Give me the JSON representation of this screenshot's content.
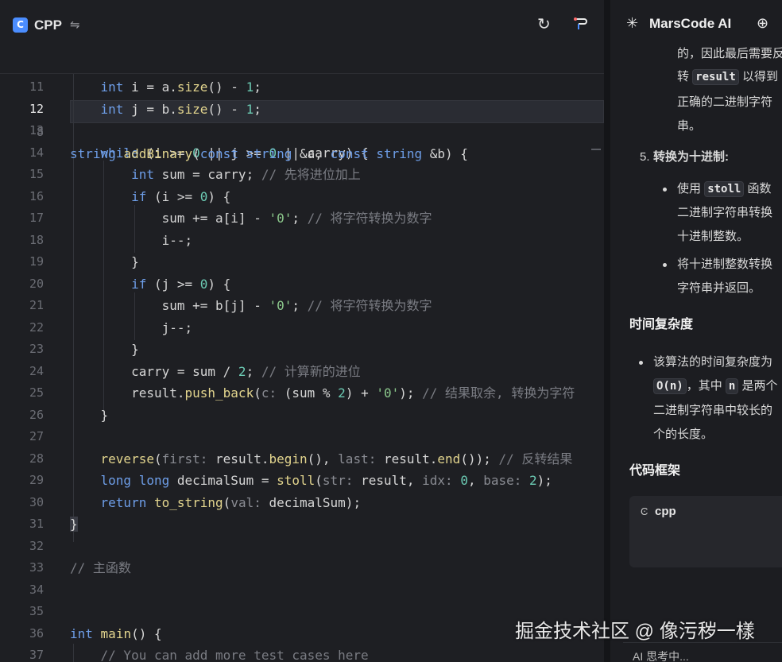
{
  "editor": {
    "language": "CPP",
    "language_icon": "C",
    "sticky_line_number": "8",
    "lines": [
      {
        "n": "11",
        "segs": [
          [
            "",
            "    "
          ],
          [
            "kw",
            "int"
          ],
          [
            "",
            " i = a."
          ],
          [
            "fn",
            "size"
          ],
          [
            "",
            "() - "
          ],
          [
            "num",
            "1"
          ],
          [
            "",
            ";"
          ]
        ]
      },
      {
        "n": "12",
        "segs": [
          [
            "",
            "    "
          ],
          [
            "kw",
            "int"
          ],
          [
            "",
            " j = b."
          ],
          [
            "fn",
            "size"
          ],
          [
            "",
            "() - "
          ],
          [
            "num",
            "1"
          ],
          [
            "",
            ";"
          ]
        ]
      },
      {
        "n": "13",
        "segs": []
      },
      {
        "n": "14",
        "segs": [
          [
            "",
            "    "
          ],
          [
            "kw",
            "while"
          ],
          [
            "",
            " (i >= "
          ],
          [
            "num",
            "0"
          ],
          [
            "",
            " || j >= "
          ],
          [
            "num",
            "0"
          ],
          [
            "",
            " || carry) {"
          ]
        ]
      },
      {
        "n": "15",
        "segs": [
          [
            "",
            "        "
          ],
          [
            "kw",
            "int"
          ],
          [
            "",
            " sum = carry; "
          ],
          [
            "cm",
            "// 先将进位加上"
          ]
        ]
      },
      {
        "n": "16",
        "segs": [
          [
            "",
            "        "
          ],
          [
            "kw",
            "if"
          ],
          [
            "",
            " (i >= "
          ],
          [
            "num",
            "0"
          ],
          [
            "",
            ") {"
          ]
        ]
      },
      {
        "n": "17",
        "segs": [
          [
            "",
            "            sum += a[i] - "
          ],
          [
            "str",
            "'0'"
          ],
          [
            "",
            "; "
          ],
          [
            "cm",
            "// 将字符转换为数字"
          ]
        ]
      },
      {
        "n": "18",
        "segs": [
          [
            "",
            "            i--;"
          ]
        ]
      },
      {
        "n": "19",
        "segs": [
          [
            "",
            "        }"
          ]
        ]
      },
      {
        "n": "20",
        "segs": [
          [
            "",
            "        "
          ],
          [
            "kw",
            "if"
          ],
          [
            "",
            " (j >= "
          ],
          [
            "num",
            "0"
          ],
          [
            "",
            ") {"
          ]
        ]
      },
      {
        "n": "21",
        "segs": [
          [
            "",
            "            sum += b[j] - "
          ],
          [
            "str",
            "'0'"
          ],
          [
            "",
            "; "
          ],
          [
            "cm",
            "// 将字符转换为数字"
          ]
        ]
      },
      {
        "n": "22",
        "segs": [
          [
            "",
            "            j--;"
          ]
        ]
      },
      {
        "n": "23",
        "segs": [
          [
            "",
            "        }"
          ]
        ]
      },
      {
        "n": "24",
        "segs": [
          [
            "",
            "        carry = sum / "
          ],
          [
            "num",
            "2"
          ],
          [
            "",
            "; "
          ],
          [
            "cm",
            "// 计算新的进位"
          ]
        ]
      },
      {
        "n": "25",
        "segs": [
          [
            "",
            "        result."
          ],
          [
            "fn",
            "push_back"
          ],
          [
            "",
            "("
          ],
          [
            "hint",
            "c:"
          ],
          [
            "",
            " (sum % "
          ],
          [
            "num",
            "2"
          ],
          [
            "",
            ") + "
          ],
          [
            "str",
            "'0'"
          ],
          [
            "",
            "); "
          ],
          [
            "cm",
            "// 结果取余, 转换为字符"
          ]
        ]
      },
      {
        "n": "26",
        "segs": [
          [
            "",
            "    }"
          ]
        ]
      },
      {
        "n": "27",
        "segs": []
      },
      {
        "n": "28",
        "segs": [
          [
            "",
            "    "
          ],
          [
            "fn",
            "reverse"
          ],
          [
            "",
            "("
          ],
          [
            "hint",
            "first:"
          ],
          [
            "",
            " result."
          ],
          [
            "fn",
            "begin"
          ],
          [
            "",
            "(), "
          ],
          [
            "hint",
            "last:"
          ],
          [
            "",
            " result."
          ],
          [
            "fn",
            "end"
          ],
          [
            "",
            "()); "
          ],
          [
            "cm",
            "// 反转结果"
          ]
        ]
      },
      {
        "n": "29",
        "segs": [
          [
            "",
            "    "
          ],
          [
            "kw",
            "long long"
          ],
          [
            "",
            " decimalSum = "
          ],
          [
            "fn",
            "stoll"
          ],
          [
            "",
            "("
          ],
          [
            "hint",
            "str:"
          ],
          [
            "",
            " result, "
          ],
          [
            "hint",
            "idx:"
          ],
          [
            "",
            " "
          ],
          [
            "num",
            "0"
          ],
          [
            "",
            ", "
          ],
          [
            "hint",
            "base:"
          ],
          [
            "",
            " "
          ],
          [
            "num",
            "2"
          ],
          [
            "",
            ");"
          ]
        ]
      },
      {
        "n": "30",
        "segs": [
          [
            "",
            "    "
          ],
          [
            "kw",
            "return"
          ],
          [
            "",
            " "
          ],
          [
            "fn",
            "to_string"
          ],
          [
            "",
            "("
          ],
          [
            "hint",
            "val:"
          ],
          [
            "",
            " decimalSum);"
          ]
        ]
      },
      {
        "n": "31",
        "segs": [
          [
            "brace",
            "}"
          ]
        ]
      },
      {
        "n": "32",
        "segs": []
      },
      {
        "n": "33",
        "segs": [
          [
            "cm",
            "// 主函数"
          ]
        ]
      },
      {
        "n": "34",
        "segs": []
      },
      {
        "n": "35",
        "segs": []
      },
      {
        "n": "36",
        "segs": [
          [
            "kw",
            "int"
          ],
          [
            "",
            " "
          ],
          [
            "fn",
            "main"
          ],
          [
            "",
            "() {"
          ]
        ]
      },
      {
        "n": "37",
        "segs": [
          [
            "",
            "    "
          ],
          [
            "cm",
            "// You can add more test cases here"
          ]
        ]
      }
    ],
    "sticky_segs": [
      [
        "kw",
        "string"
      ],
      [
        "",
        " "
      ],
      [
        "fn",
        "addBinary"
      ],
      [
        "",
        "("
      ],
      [
        "kw",
        "const string"
      ],
      [
        "",
        " &a, "
      ],
      [
        "kw",
        "const string"
      ],
      [
        "",
        " &b) {"
      ]
    ],
    "current_line": "12"
  },
  "panel": {
    "title": "MarsCode AI",
    "top_lines": [
      "的，因此最后需要反",
      "以得到",
      "正确的二进制字符",
      "串。"
    ],
    "top_prefix": "转",
    "top_code": "result",
    "step5_number": "5.",
    "step5_title": "转换为十进制",
    "step5_colon": ":",
    "b1_prefix": "使用",
    "b1_code": "stoll",
    "b1_suffix": "函数",
    "b1_line2": "二进制字符串转换",
    "b1_line3": "十进制整数。",
    "b2_line1": "将十进制整数转换",
    "b2_line2": "字符串并返回。",
    "time_heading": "时间复杂度",
    "t_line1": "该算法的时间复杂度为",
    "t_code": "O(n)",
    "t_mid": "，其中",
    "t_n": "n",
    "t_tail": "是两个",
    "t_line3": "二进制字符串中较长的",
    "t_line4": "个的长度。",
    "frame_heading": "代码框架",
    "card_label": "cpp",
    "thinking": "AI 思考中..."
  },
  "watermark": "掘金技术社区 @ 像污秽一樣",
  "colors": {
    "keyword": "#6e9ee8",
    "function": "#e3d58e",
    "number": "#6ccbb4",
    "string": "#8cc98c",
    "comment": "#7a7c83",
    "accent": "#4b8dff"
  },
  "icons": {
    "language": "cpp-logo-icon",
    "swap": "swap-icon",
    "refresh": "refresh-icon",
    "ai_fix": "ai-fix-icon",
    "marscode": "sparkle-icon",
    "new_chat": "new-chat-icon"
  }
}
